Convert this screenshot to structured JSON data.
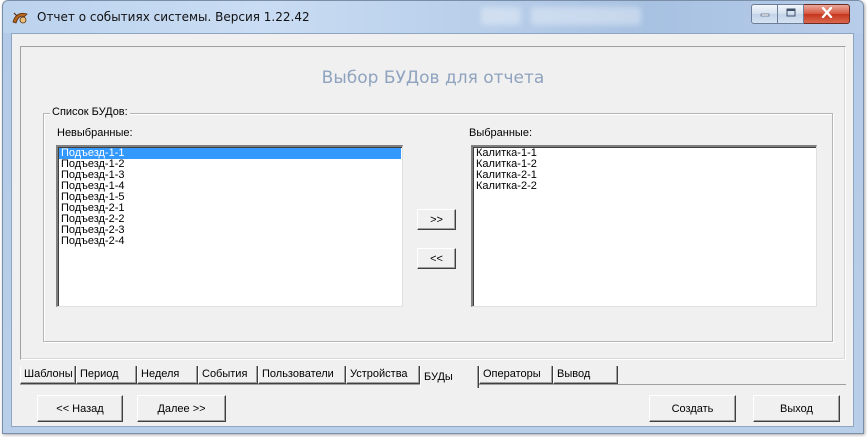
{
  "window": {
    "title": "Отчет о событиях системы.  Версия 1.22.42"
  },
  "page": {
    "heading": "Выбор БУДов для отчета"
  },
  "group": {
    "label": "Список БУДов:",
    "unselected_label": "Невыбранные:",
    "selected_label": "Выбранные:",
    "unselected_items": [
      "Подъезд-1-1",
      "Подъезд-1-2",
      "Подъезд-1-3",
      "Подъезд-1-4",
      "Подъезд-1-5",
      "Подъезд-2-1",
      "Подъезд-2-2",
      "Подъезд-2-3",
      "Подъезд-2-4"
    ],
    "selected_items": [
      "Калитка-1-1",
      "Калитка-1-2",
      "Калитка-2-1",
      "Калитка-2-2"
    ],
    "highlighted_index": 0,
    "move_right": ">>",
    "move_left": "<<"
  },
  "tabs": [
    {
      "label": "Шаблоны"
    },
    {
      "label": "Период"
    },
    {
      "label": "Неделя"
    },
    {
      "label": "События"
    },
    {
      "label": "Пользователи"
    },
    {
      "label": "Устройства"
    },
    {
      "label": "БУДы",
      "active": true
    },
    {
      "label": "Операторы"
    },
    {
      "label": "Вывод"
    }
  ],
  "footer": {
    "back": "<< Назад",
    "next": "Далее >>",
    "create": "Создать",
    "exit": "Выход"
  },
  "colors": {
    "selection": "#3399ff",
    "heading": "#8fa3bf",
    "close_button": "#c6351c"
  },
  "icons": {
    "app": "app-icon",
    "minimize": "minimize-icon",
    "maximize": "maximize-icon",
    "close": "close-icon"
  }
}
